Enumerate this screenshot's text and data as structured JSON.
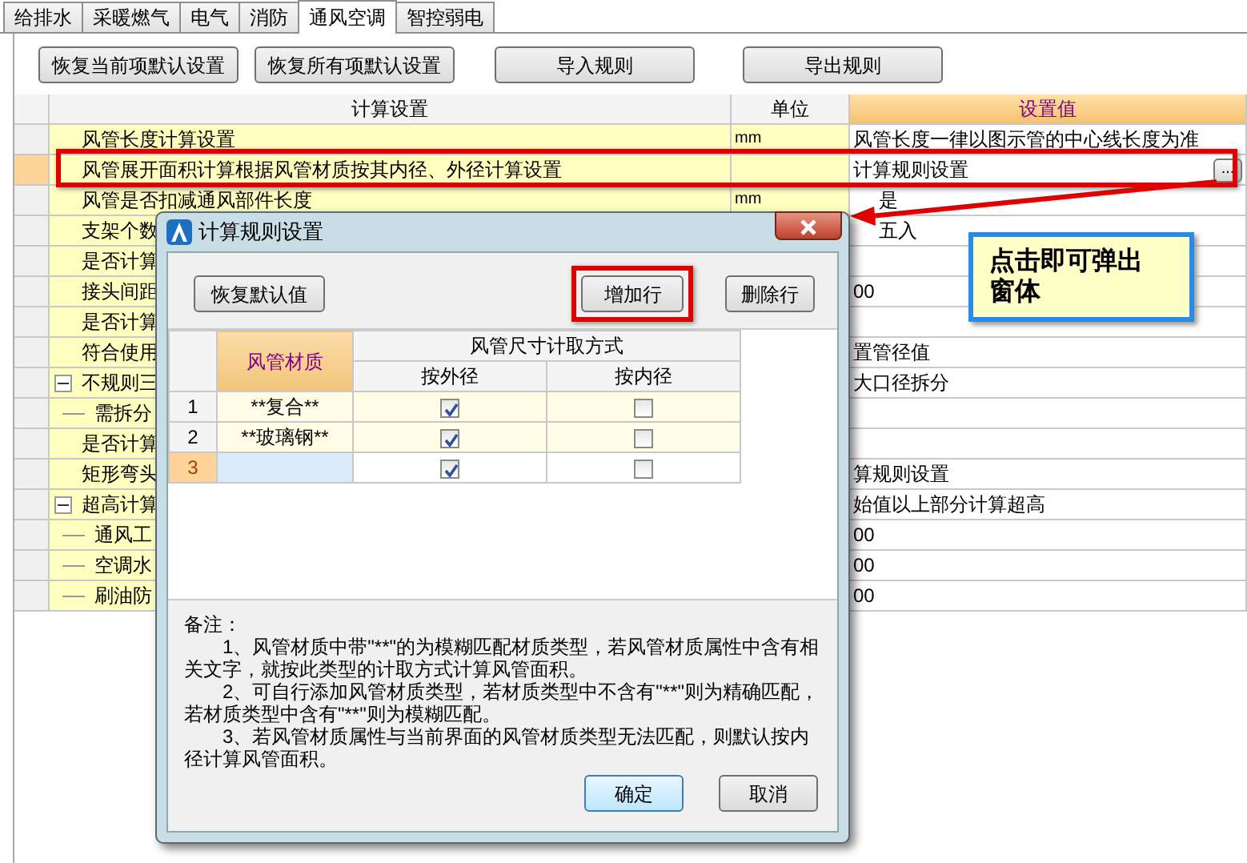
{
  "tabs": [
    {
      "label": "给排水",
      "selected": false
    },
    {
      "label": "采暖燃气",
      "selected": false
    },
    {
      "label": "电气",
      "selected": false
    },
    {
      "label": "消防",
      "selected": false
    },
    {
      "label": "通风空调",
      "selected": true
    },
    {
      "label": "智控弱电",
      "selected": false
    }
  ],
  "toolbar": [
    "恢复当前项默认设置",
    "恢复所有项默认设置",
    "导入规则",
    "导出规则"
  ],
  "grid": {
    "columns": [
      "计算设置",
      "单位",
      "设置值"
    ],
    "rows": [
      {
        "name": "风管长度计算设置",
        "unit": "mm",
        "value": "风管长度一律以图示管的中心线长度为准",
        "selected": false,
        "highlighted": false
      },
      {
        "name": "风管展开面积计算根据风管材质按其内径、外径计算设置",
        "value": "计算规则设置",
        "selected": true,
        "highlighted": true,
        "button_label": "..."
      },
      {
        "name": "风管是否扣减通风部件长度",
        "unit": "mm",
        "value": "是",
        "selected": false,
        "highlighted": false
      },
      {
        "name": "支架个数",
        "value": "五入",
        "selected": false,
        "highlighted": false
      },
      {
        "name": "是否计算",
        "selected": false,
        "highlighted": false
      },
      {
        "name": "接头间距",
        "value": "00",
        "selected": false,
        "highlighted": false
      },
      {
        "name": "是否计算",
        "selected": false,
        "highlighted": false
      },
      {
        "name": "符合使用",
        "value": "置管径值",
        "selected": false,
        "highlighted": false
      },
      {
        "name": "不规则三",
        "value": "大口径拆分",
        "selected": false,
        "highlighted": false,
        "expanded": true,
        "children": [
          {
            "name": "需拆分",
            "selected": false,
            "highlighted": false
          }
        ]
      },
      {
        "name": "是否计算",
        "selected": false,
        "highlighted": false
      },
      {
        "name": "矩形弯头",
        "value": "算规则设置",
        "selected": false,
        "highlighted": false
      },
      {
        "name": "超高计算",
        "value": "始值以上部分计算超高",
        "selected": false,
        "highlighted": false,
        "expanded": true,
        "children": [
          {
            "name": "通风工",
            "value": "00",
            "selected": false,
            "highlighted": false
          },
          {
            "name": "空调水",
            "value": "00",
            "selected": false,
            "highlighted": false
          },
          {
            "name": "刷油防",
            "value": "00",
            "selected": false,
            "highlighted": false
          }
        ]
      }
    ]
  },
  "callout": {
    "text": "点击即可弹出窗体"
  },
  "dialog": {
    "title": "计算规则设置",
    "buttons": [
      {
        "label": "恢复默认值",
        "highlighted": false
      },
      {
        "label": "增加行",
        "highlighted": true
      },
      {
        "label": "删除行",
        "highlighted": false
      }
    ],
    "table": {
      "material_header": "风管材质",
      "group_header": "风管尺寸计取方式",
      "sub_headers": [
        "按外径",
        "按内径"
      ],
      "rows": [
        {
          "index": "1",
          "material": "**复合**",
          "outer": true,
          "inner": false,
          "selected": false
        },
        {
          "index": "2",
          "material": "**玻璃钢**",
          "outer": true,
          "inner": false,
          "selected": false
        },
        {
          "index": "3",
          "outer": true,
          "inner": false,
          "selected": true
        }
      ]
    },
    "notes_title": "备注：",
    "notes": [
      "1、风管材质中带\"**\"的为模糊匹配材质类型，若风管材质属性中含有相关文字，就按此类型的计取方式计算风管面积。",
      "2、可自行添加风管材质类型，若材质类型中不含有\"**\"则为精确匹配，若材质类型中含有\"**\"则为模糊匹配。",
      "3、若风管材质属性与当前界面的风管材质类型无法匹配，则默认按内径计算风管面积。"
    ],
    "footer_buttons": [
      {
        "label": "确定",
        "default": true
      },
      {
        "label": "取消",
        "default": false
      }
    ]
  }
}
